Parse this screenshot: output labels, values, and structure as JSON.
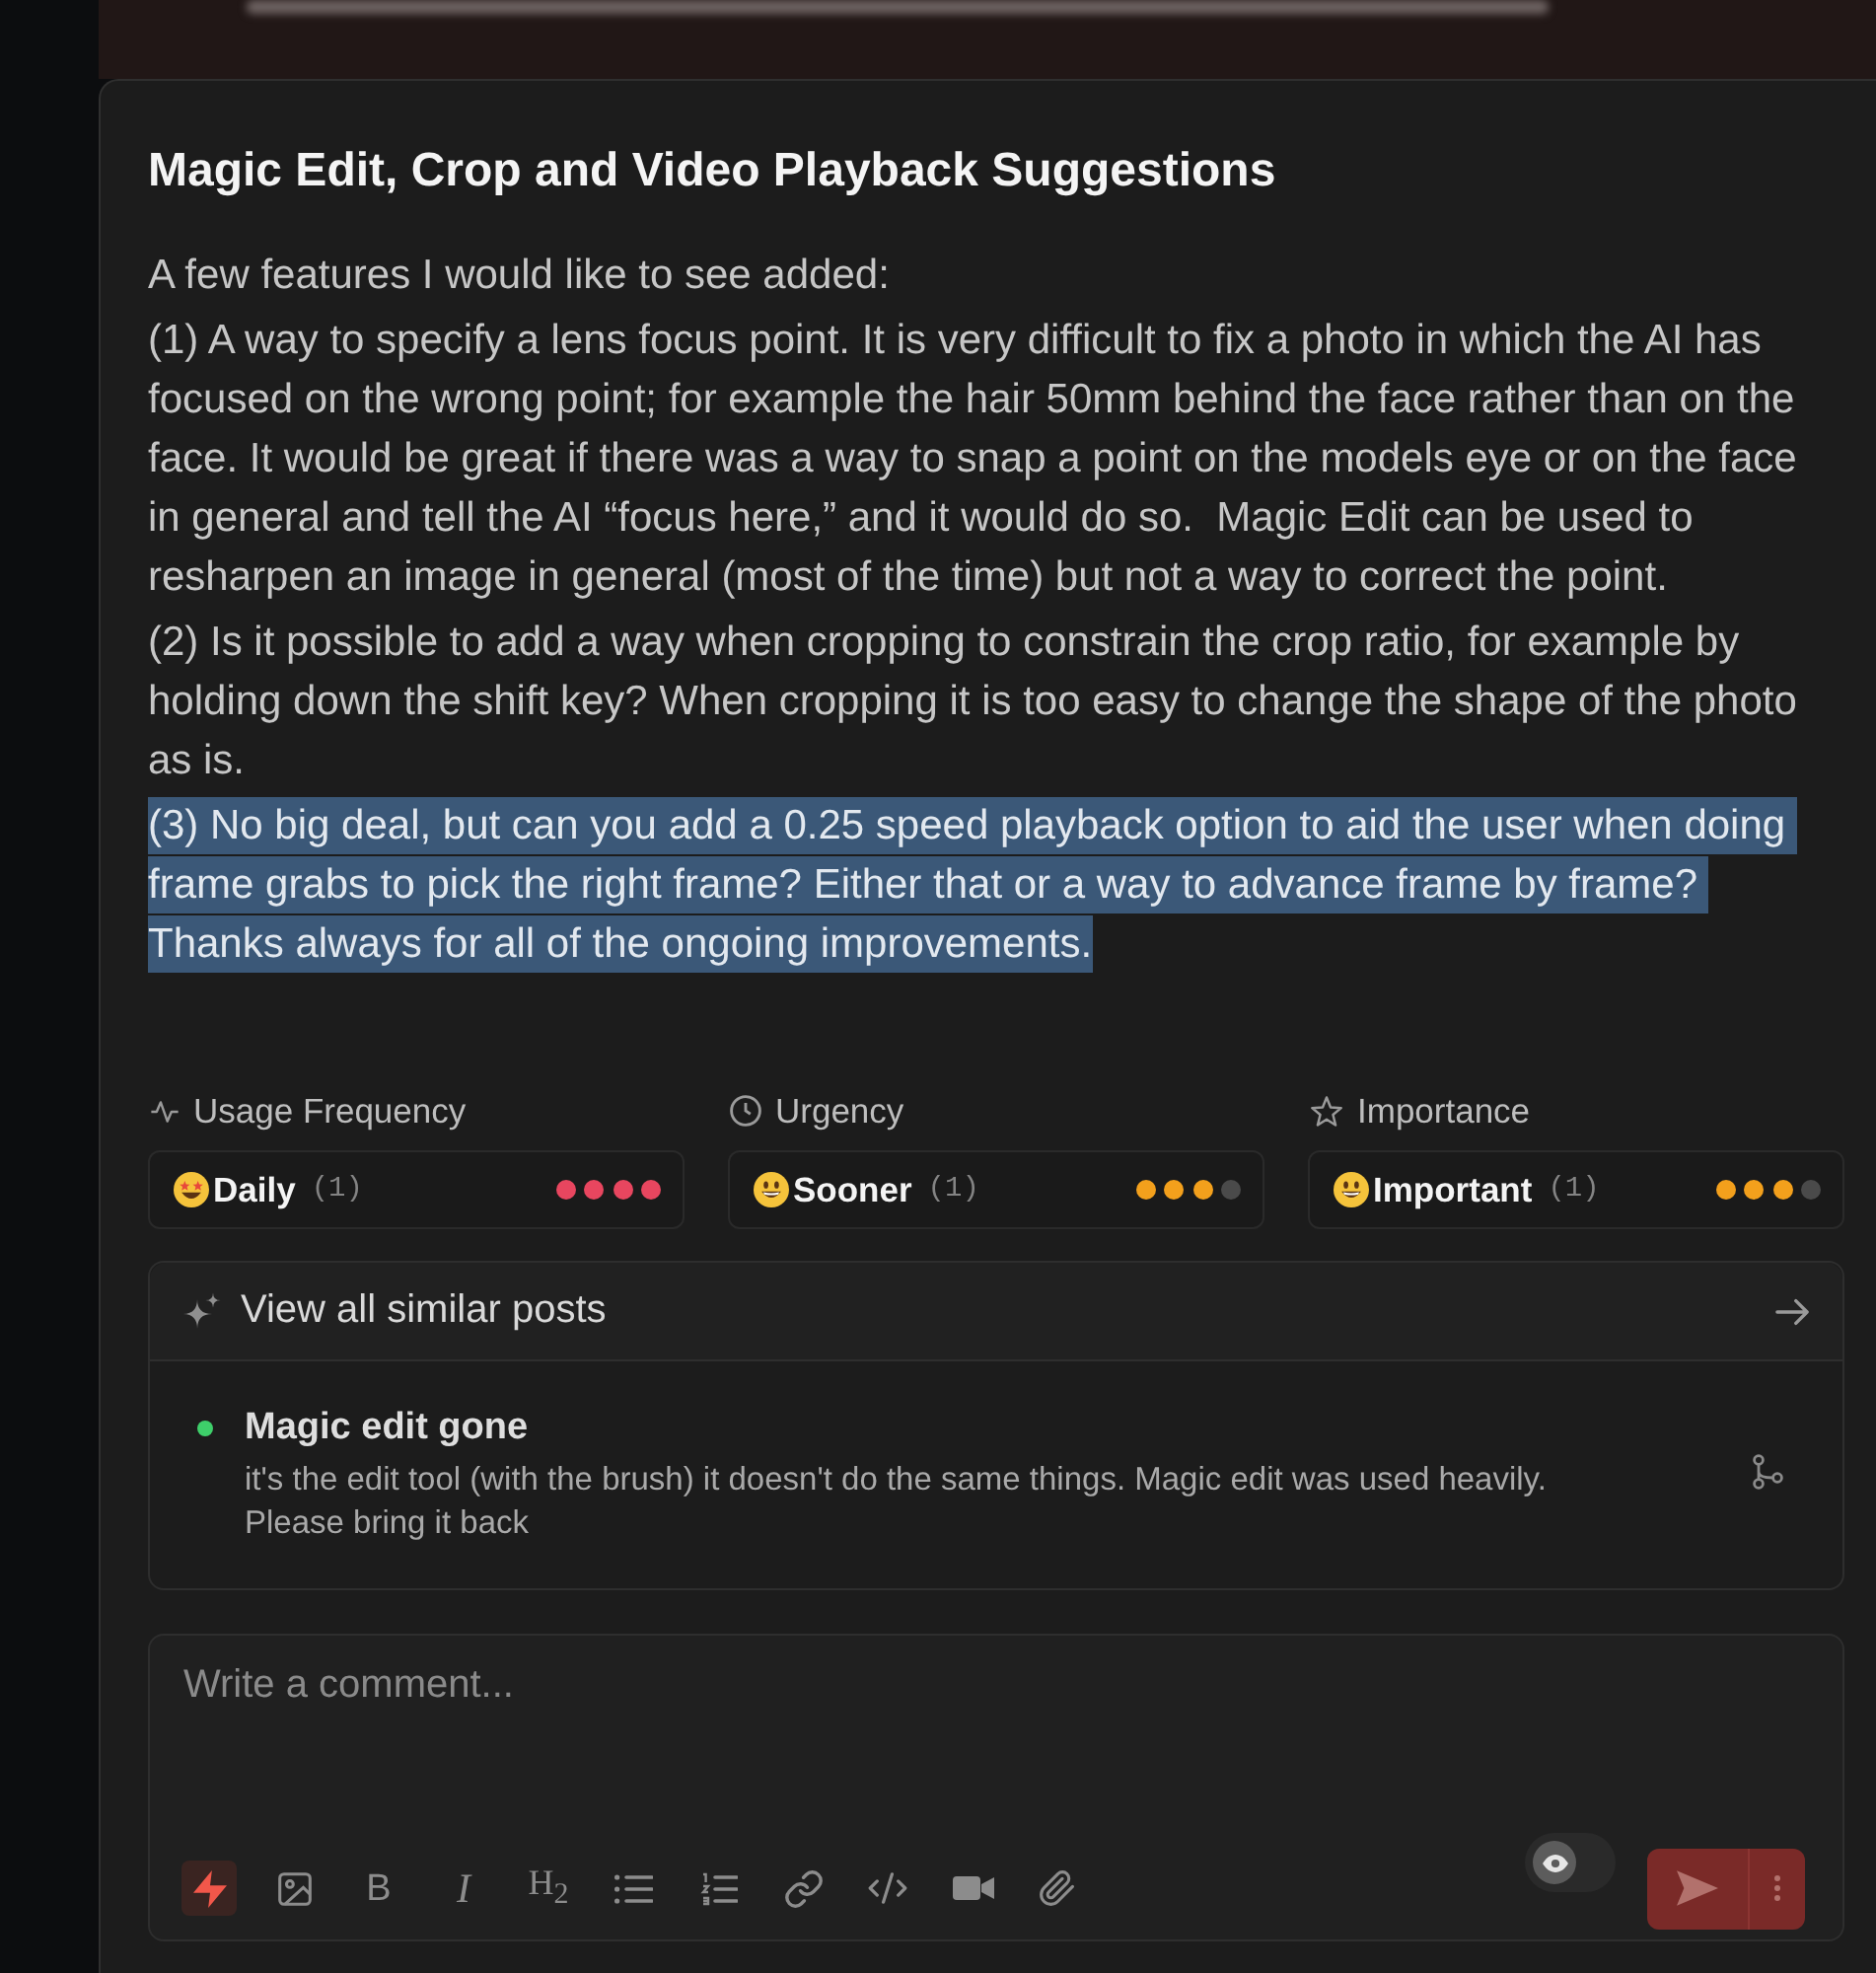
{
  "post": {
    "title": "Magic Edit, Crop and Video Playback Suggestions",
    "body": [
      {
        "text": "A few features I would like to see added:",
        "highlighted": false
      },
      {
        "text": "(1) A way to specify a lens focus point. It is very difficult to fix a photo in which the AI has focused on the wrong point; for example the hair 50mm behind the face rather than on the face. It would be great if there was a way to snap a point on the models eye or on the face in general and tell the AI “focus here,” and it would do so.  Magic Edit can be used to resharpen an image in general (most of the time) but not a way to correct the point.",
        "highlighted": false
      },
      {
        "text": "(2) Is it possible to add a way when cropping to constrain the crop ratio, for example by holding down the shift key? When cropping it is too easy to change the shape of the photo as is.",
        "highlighted": false
      },
      {
        "text": "(3) No big deal, but can you add a 0.25 speed playback option to aid the user when doing frame grabs to pick the right frame? Either that or a way to advance frame by frame? Thanks always for all of the ongoing improvements.",
        "highlighted": true
      }
    ]
  },
  "metrics": [
    {
      "kind": "frequency",
      "label": "Usage Frequency",
      "value": "Daily",
      "count": "(1)",
      "stars": 4,
      "color": "#e8465f"
    },
    {
      "kind": "urgency",
      "label": "Urgency",
      "value": "Sooner",
      "count": "(1)",
      "stars": 3,
      "color": "#f3a01c"
    },
    {
      "kind": "importance",
      "label": "Importance",
      "value": "Important",
      "count": "(1)",
      "stars": 3,
      "color": "#f3a01c"
    }
  ],
  "similar": {
    "heading": "View all similar posts",
    "posts": [
      {
        "title": "Magic edit gone",
        "description": "it's the edit tool (with the brush) it doesn't do the same things. Magic edit was used heavily. Please bring it back",
        "color": "#3ecf6a"
      }
    ]
  },
  "comment": {
    "placeholder": "Write a comment...",
    "tools": [
      {
        "kind": "ai",
        "on": true
      },
      {
        "kind": "image",
        "on": false
      },
      {
        "kind": "bold",
        "label": "B",
        "on": false
      },
      {
        "kind": "italic",
        "label": "I",
        "on": false
      },
      {
        "kind": "heading",
        "label": "H$_{2}$",
        "on": false
      },
      {
        "kind": "bullets",
        "on": false
      },
      {
        "kind": "numbers",
        "on": false
      },
      {
        "kind": "link",
        "on": false
      },
      {
        "kind": "code",
        "on": false
      },
      {
        "kind": "video",
        "on": false
      },
      {
        "kind": "attach",
        "on": false
      }
    ],
    "preview_toggle": {
      "on": false
    },
    "send_button": {
      "disabled": true
    }
  }
}
